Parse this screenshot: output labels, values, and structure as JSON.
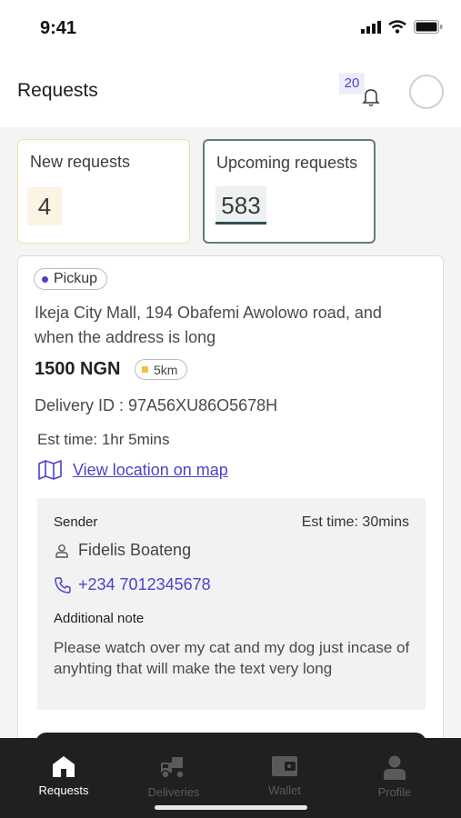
{
  "status": {
    "time": "9:41"
  },
  "header": {
    "title": "Requests",
    "notification_count": "20"
  },
  "stats": {
    "new": {
      "label": "New requests",
      "value": "4"
    },
    "upcoming": {
      "label": "Upcoming requests",
      "value": "583"
    }
  },
  "request": {
    "badge": "Pickup",
    "address": "Ikeja City Mall, 194 Obafemi Awolowo road, and when the address is long",
    "price": "1500 NGN",
    "distance": "5km",
    "delivery_id": "Delivery ID : 97A56XU86O5678H",
    "est_time": "Est time: 1hr 5mins",
    "map_link": "View location on map",
    "sender": {
      "label": "Sender",
      "est_time": "Est time: 30mins",
      "name": "Fidelis Boateng",
      "phone": "+234 7012345678",
      "note_label": "Additional note",
      "note": "Please watch over my cat and my dog just incase of anyhting that will make the text very long"
    }
  },
  "nav": {
    "items": [
      {
        "label": "Requests",
        "icon": "home-icon",
        "active": true
      },
      {
        "label": "Deliveries",
        "icon": "truck-icon",
        "active": false
      },
      {
        "label": "Wallet",
        "icon": "wallet-icon",
        "active": false
      },
      {
        "label": "Profile",
        "icon": "profile-icon",
        "active": false
      }
    ]
  },
  "colors": {
    "accent": "#4a44c8",
    "nav_bg": "#202020",
    "upcoming_border": "#5f7d7a",
    "new_border": "#f3dfa6"
  }
}
